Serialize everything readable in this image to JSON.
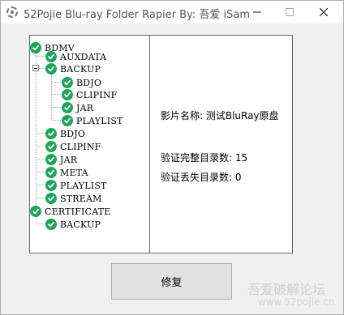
{
  "window": {
    "title": "52Pojie Blu-ray Folder Rapier By: 吾爱 iSam"
  },
  "tree": {
    "items": [
      {
        "label": "BDMV"
      },
      {
        "label": "AUXDATA"
      },
      {
        "label": "BACKUP"
      },
      {
        "label": "BDJO"
      },
      {
        "label": "CLIPINF"
      },
      {
        "label": "JAR"
      },
      {
        "label": "PLAYLIST"
      },
      {
        "label": "BDJO"
      },
      {
        "label": "CLIPINF"
      },
      {
        "label": "JAR"
      },
      {
        "label": "META"
      },
      {
        "label": "PLAYLIST"
      },
      {
        "label": "STREAM"
      },
      {
        "label": "CERTIFICATE"
      },
      {
        "label": "BACKUP"
      }
    ]
  },
  "info": {
    "movie_name": "影片名称: 测试BluRay原盘",
    "verified_dirs": "验证完整目录数: 15",
    "missing_dirs": "验证丢失目录数: 0"
  },
  "buttons": {
    "repair_label": "修复"
  },
  "watermark": {
    "site_name": "吾爱破解论坛",
    "site_url": "www.52pojie.cn"
  },
  "colors": {
    "check": "#1ea55a",
    "border": "#646464"
  }
}
